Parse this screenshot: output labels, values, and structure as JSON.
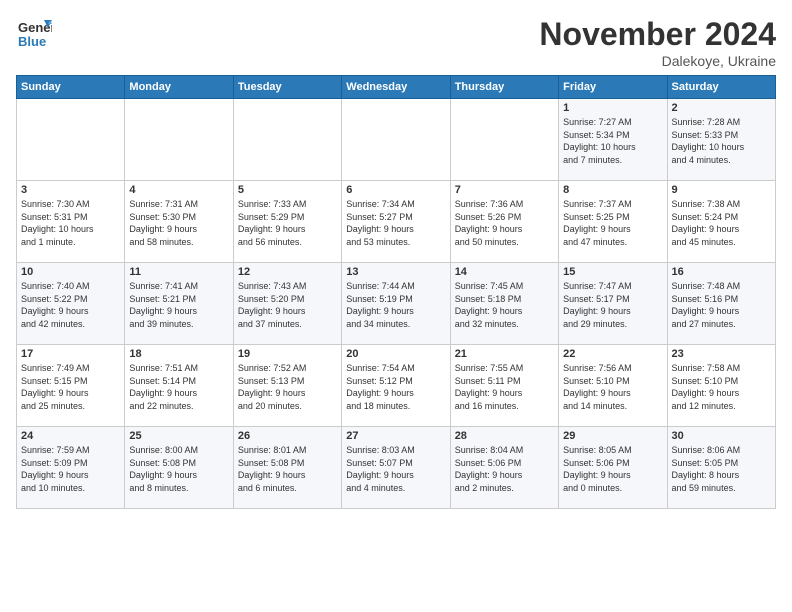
{
  "logo": {
    "line1": "General",
    "line2": "Blue"
  },
  "header": {
    "month": "November 2024",
    "location": "Dalekoye, Ukraine"
  },
  "weekdays": [
    "Sunday",
    "Monday",
    "Tuesday",
    "Wednesday",
    "Thursday",
    "Friday",
    "Saturday"
  ],
  "weeks": [
    [
      {
        "day": "",
        "info": ""
      },
      {
        "day": "",
        "info": ""
      },
      {
        "day": "",
        "info": ""
      },
      {
        "day": "",
        "info": ""
      },
      {
        "day": "",
        "info": ""
      },
      {
        "day": "1",
        "info": "Sunrise: 7:27 AM\nSunset: 5:34 PM\nDaylight: 10 hours\nand 7 minutes."
      },
      {
        "day": "2",
        "info": "Sunrise: 7:28 AM\nSunset: 5:33 PM\nDaylight: 10 hours\nand 4 minutes."
      }
    ],
    [
      {
        "day": "3",
        "info": "Sunrise: 7:30 AM\nSunset: 5:31 PM\nDaylight: 10 hours\nand 1 minute."
      },
      {
        "day": "4",
        "info": "Sunrise: 7:31 AM\nSunset: 5:30 PM\nDaylight: 9 hours\nand 58 minutes."
      },
      {
        "day": "5",
        "info": "Sunrise: 7:33 AM\nSunset: 5:29 PM\nDaylight: 9 hours\nand 56 minutes."
      },
      {
        "day": "6",
        "info": "Sunrise: 7:34 AM\nSunset: 5:27 PM\nDaylight: 9 hours\nand 53 minutes."
      },
      {
        "day": "7",
        "info": "Sunrise: 7:36 AM\nSunset: 5:26 PM\nDaylight: 9 hours\nand 50 minutes."
      },
      {
        "day": "8",
        "info": "Sunrise: 7:37 AM\nSunset: 5:25 PM\nDaylight: 9 hours\nand 47 minutes."
      },
      {
        "day": "9",
        "info": "Sunrise: 7:38 AM\nSunset: 5:24 PM\nDaylight: 9 hours\nand 45 minutes."
      }
    ],
    [
      {
        "day": "10",
        "info": "Sunrise: 7:40 AM\nSunset: 5:22 PM\nDaylight: 9 hours\nand 42 minutes."
      },
      {
        "day": "11",
        "info": "Sunrise: 7:41 AM\nSunset: 5:21 PM\nDaylight: 9 hours\nand 39 minutes."
      },
      {
        "day": "12",
        "info": "Sunrise: 7:43 AM\nSunset: 5:20 PM\nDaylight: 9 hours\nand 37 minutes."
      },
      {
        "day": "13",
        "info": "Sunrise: 7:44 AM\nSunset: 5:19 PM\nDaylight: 9 hours\nand 34 minutes."
      },
      {
        "day": "14",
        "info": "Sunrise: 7:45 AM\nSunset: 5:18 PM\nDaylight: 9 hours\nand 32 minutes."
      },
      {
        "day": "15",
        "info": "Sunrise: 7:47 AM\nSunset: 5:17 PM\nDaylight: 9 hours\nand 29 minutes."
      },
      {
        "day": "16",
        "info": "Sunrise: 7:48 AM\nSunset: 5:16 PM\nDaylight: 9 hours\nand 27 minutes."
      }
    ],
    [
      {
        "day": "17",
        "info": "Sunrise: 7:49 AM\nSunset: 5:15 PM\nDaylight: 9 hours\nand 25 minutes."
      },
      {
        "day": "18",
        "info": "Sunrise: 7:51 AM\nSunset: 5:14 PM\nDaylight: 9 hours\nand 22 minutes."
      },
      {
        "day": "19",
        "info": "Sunrise: 7:52 AM\nSunset: 5:13 PM\nDaylight: 9 hours\nand 20 minutes."
      },
      {
        "day": "20",
        "info": "Sunrise: 7:54 AM\nSunset: 5:12 PM\nDaylight: 9 hours\nand 18 minutes."
      },
      {
        "day": "21",
        "info": "Sunrise: 7:55 AM\nSunset: 5:11 PM\nDaylight: 9 hours\nand 16 minutes."
      },
      {
        "day": "22",
        "info": "Sunrise: 7:56 AM\nSunset: 5:10 PM\nDaylight: 9 hours\nand 14 minutes."
      },
      {
        "day": "23",
        "info": "Sunrise: 7:58 AM\nSunset: 5:10 PM\nDaylight: 9 hours\nand 12 minutes."
      }
    ],
    [
      {
        "day": "24",
        "info": "Sunrise: 7:59 AM\nSunset: 5:09 PM\nDaylight: 9 hours\nand 10 minutes."
      },
      {
        "day": "25",
        "info": "Sunrise: 8:00 AM\nSunset: 5:08 PM\nDaylight: 9 hours\nand 8 minutes."
      },
      {
        "day": "26",
        "info": "Sunrise: 8:01 AM\nSunset: 5:08 PM\nDaylight: 9 hours\nand 6 minutes."
      },
      {
        "day": "27",
        "info": "Sunrise: 8:03 AM\nSunset: 5:07 PM\nDaylight: 9 hours\nand 4 minutes."
      },
      {
        "day": "28",
        "info": "Sunrise: 8:04 AM\nSunset: 5:06 PM\nDaylight: 9 hours\nand 2 minutes."
      },
      {
        "day": "29",
        "info": "Sunrise: 8:05 AM\nSunset: 5:06 PM\nDaylight: 9 hours\nand 0 minutes."
      },
      {
        "day": "30",
        "info": "Sunrise: 8:06 AM\nSunset: 5:05 PM\nDaylight: 8 hours\nand 59 minutes."
      }
    ]
  ]
}
